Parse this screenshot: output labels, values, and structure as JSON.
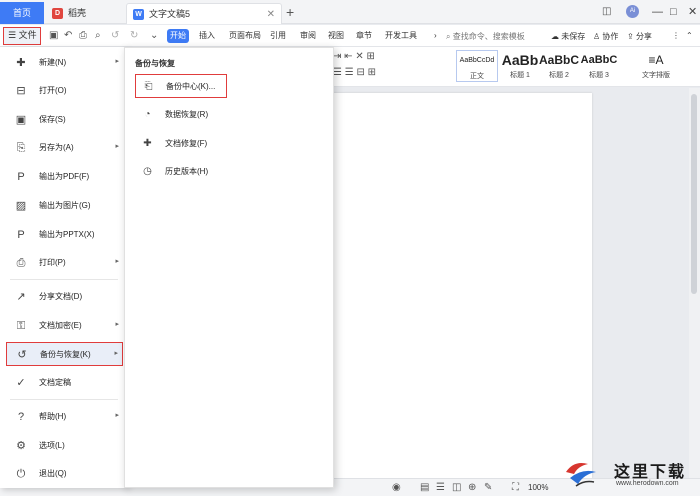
{
  "titlebar": {
    "home_tab": "首页",
    "tabs": [
      {
        "label": "稻壳",
        "icon": "daoke-icon",
        "color": "#e0463f"
      },
      {
        "label": "文字文稿5",
        "icon": "writer-doc-icon",
        "color": "#3e7bf5"
      }
    ],
    "add_tab": "+",
    "avatar": "Ai",
    "window_controls": [
      "—",
      "□",
      "✕"
    ]
  },
  "toolbar": {
    "file_label": "文件",
    "menu_tabs": [
      "开始",
      "插入",
      "页面布局",
      "引用",
      "审阅",
      "视图",
      "章节",
      "开发工具"
    ],
    "search_placeholder": "查找命令、搜索模板",
    "unsaved": "未保存",
    "collaborate": "协作",
    "share": "分享"
  },
  "ribbon": {
    "styles": [
      {
        "preview": "AaBbCcDd",
        "label": "正文"
      },
      {
        "preview": "AaBb",
        "label": "标题 1"
      },
      {
        "preview": "AaBbC",
        "label": "标题 2"
      },
      {
        "preview": "AaBbC",
        "label": "标题 3"
      }
    ],
    "text_layout": "文字排版"
  },
  "file_menu": {
    "items": [
      {
        "label": "新建(N)",
        "icon": "new-file-icon",
        "glyph": "✚",
        "arrow": true
      },
      {
        "label": "打开(O)",
        "icon": "open-folder-icon",
        "glyph": "⊟",
        "arrow": false
      },
      {
        "label": "保存(S)",
        "icon": "save-icon",
        "glyph": "▣",
        "arrow": false
      },
      {
        "label": "另存为(A)",
        "icon": "save-as-icon",
        "glyph": "⎘",
        "arrow": true
      },
      {
        "label": "输出为PDF(F)",
        "icon": "pdf-icon",
        "glyph": "P",
        "arrow": false
      },
      {
        "label": "输出为图片(G)",
        "icon": "image-icon",
        "glyph": "▨",
        "arrow": false
      },
      {
        "label": "输出为PPTX(X)",
        "icon": "pptx-icon",
        "glyph": "P",
        "arrow": false
      },
      {
        "label": "打印(P)",
        "icon": "print-icon",
        "glyph": "⎙",
        "arrow": true
      },
      {
        "label": "分享文档(D)",
        "icon": "share-doc-icon",
        "glyph": "↗",
        "arrow": false
      },
      {
        "label": "文档加密(E)",
        "icon": "encrypt-icon",
        "glyph": "⚿",
        "arrow": true
      },
      {
        "label": "备份与恢复(K)",
        "icon": "backup-icon",
        "glyph": "↺",
        "arrow": true
      },
      {
        "label": "文档定稿",
        "icon": "finalize-icon",
        "glyph": "✓",
        "arrow": false
      },
      {
        "label": "帮助(H)",
        "icon": "help-icon",
        "glyph": "?",
        "arrow": true
      },
      {
        "label": "选项(L)",
        "icon": "gear-icon",
        "glyph": "⚙",
        "arrow": false
      },
      {
        "label": "退出(Q)",
        "icon": "exit-icon",
        "glyph": "⏻",
        "arrow": false
      }
    ]
  },
  "sub_menu": {
    "title": "备份与恢复",
    "items": [
      {
        "label": "备份中心(K)...",
        "icon": "backup-center-icon",
        "glyph": "⎗"
      },
      {
        "label": "数据恢复(R)",
        "icon": "data-recovery-icon",
        "glyph": "◔"
      },
      {
        "label": "文档修复(F)",
        "icon": "doc-repair-icon",
        "glyph": "✚"
      },
      {
        "label": "历史版本(H)",
        "icon": "history-icon",
        "glyph": "◷"
      }
    ]
  },
  "statusbar": {
    "zoom": "100%"
  },
  "watermark": {
    "title": "这里下载",
    "url": "www.herodown.com"
  }
}
